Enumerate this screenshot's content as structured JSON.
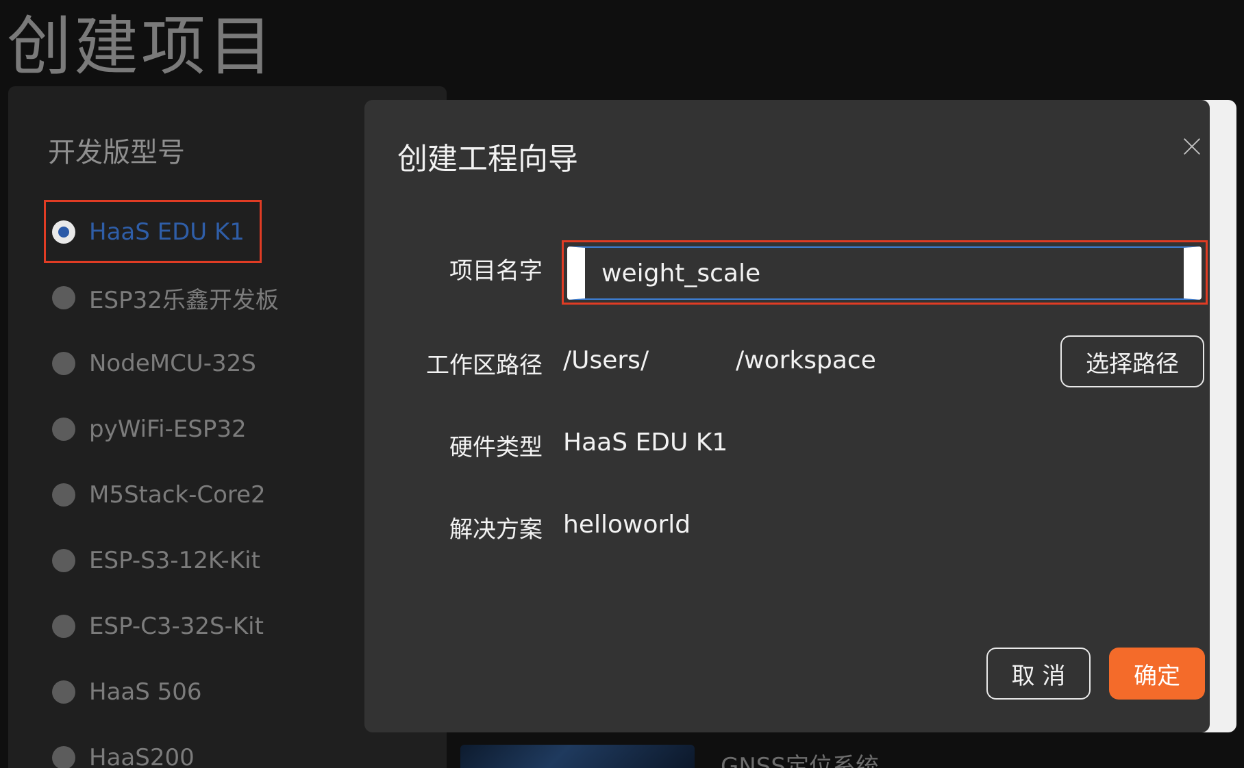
{
  "page": {
    "title": "创建项目"
  },
  "board_panel": {
    "heading": "开发版型号",
    "selected_index": 0,
    "items": [
      {
        "label": "HaaS EDU K1"
      },
      {
        "label": "ESP32乐鑫开发板"
      },
      {
        "label": "NodeMCU-32S"
      },
      {
        "label": "pyWiFi-ESP32"
      },
      {
        "label": "M5Stack-Core2"
      },
      {
        "label": "ESP-S3-12K-Kit"
      },
      {
        "label": "ESP-C3-32S-Kit"
      },
      {
        "label": "HaaS 506"
      },
      {
        "label": "HaaS200"
      }
    ]
  },
  "background_card": {
    "title": "GNSS定位系统"
  },
  "dialog": {
    "title": "创建工程向导",
    "fields": {
      "project_name_label": "项目名字",
      "project_name_value": "weight_scale",
      "workspace_label": "工作区路径",
      "workspace_path_start": "/Users/",
      "workspace_path_end": "/workspace",
      "choose_path_button": "选择路径",
      "hardware_label": "硬件类型",
      "hardware_value": "HaaS EDU K1",
      "solution_label": "解决方案",
      "solution_value": "helloworld"
    },
    "cancel_button": "取 消",
    "confirm_button": "确定"
  },
  "colors": {
    "accent_orange": "#f46b2a",
    "selected_blue": "#2f5ea8",
    "highlight_red": "#e03c24",
    "focus_blue": "#3d7fd6"
  },
  "icons": {
    "close": "close-icon",
    "radio": "radio-icon"
  }
}
